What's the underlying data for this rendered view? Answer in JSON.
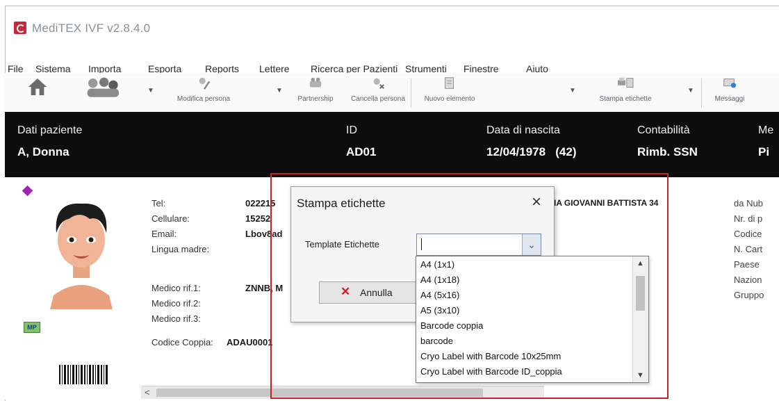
{
  "window": {
    "title": "MediTEX IVF v2.8.4.0"
  },
  "menu": [
    "File",
    "Sistema",
    "Importa",
    "Esporta",
    "Reports",
    "Lettere",
    "Ricerca per Pazienti",
    "Strumenti",
    "Finestre",
    "Aiuto"
  ],
  "toolbar": {
    "modifica": "Modifica persona",
    "partnership": "Partnership",
    "cancella": "Cancella persona",
    "nuovo": "Nuovo elemento",
    "stampa": "Stampa etichette",
    "messaggi": "Messaggi"
  },
  "patient": {
    "label_name": "Dati paziente",
    "name": "A, Donna",
    "label_id": "ID",
    "id": "AD01",
    "label_dob": "Data di nascita",
    "dob": "12/04/1978   (42)",
    "label_account": "Contabilità",
    "account": "Rimb. SSN",
    "label_partial_me": "Me",
    "partial_value": "Pi"
  },
  "details": {
    "tel_label": "Tel:",
    "tel_value": "022215",
    "cell_label": "Cellulare:",
    "cell_value": "15252",
    "email_label": "Email:",
    "email_value": "Lbov8ad",
    "lang_label": "Lingua madre:",
    "medico1_label": "Medico rif.1:",
    "medico1_value": "ZNNB, M",
    "medico2_label": "Medico rif.2:",
    "medico3_label": "Medico rif.3:",
    "coppia_label": "Codice Coppia:",
    "coppia_value": "ADAU0001",
    "address_partial": "IA GIOVANNI BATTISTA 34",
    "badge": "MP",
    "right_labels": [
      "da Nub",
      "Nr. di p",
      "Codice",
      "N. Cart",
      "Paese",
      "Nazion",
      "Gruppo"
    ]
  },
  "dialog": {
    "title": "Stampa etichette",
    "close": "×",
    "template_label": "Template Etichette",
    "combo_value": "",
    "cancel_label": "Annulla",
    "options": [
      "A4 (1x1)",
      "A4 (1x18)",
      "A4 (5x16)",
      "A5 (3x10)",
      "Barcode coppia",
      "barcode",
      "Cryo Label with Barcode 10x25mm",
      "Cryo Label with Barcode ID_coppia"
    ]
  },
  "colors": {
    "patient_bar": "#0d0d0d",
    "highlight": "#cc1f2a",
    "cancel_x": "#d11d2c",
    "diamond": "#9c27b0"
  }
}
